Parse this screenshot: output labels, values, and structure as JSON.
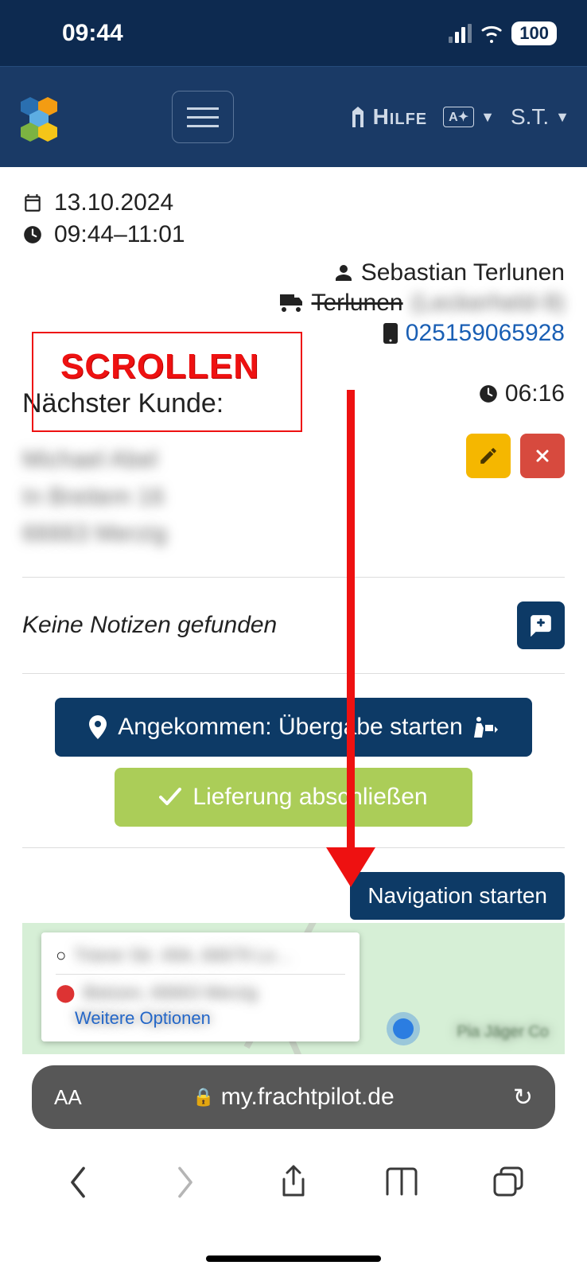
{
  "status": {
    "time": "09:44",
    "battery": "100"
  },
  "nav": {
    "help": "Hilfe",
    "lang_badge": "A✦",
    "user_short": "S.T."
  },
  "tour": {
    "date": "13.10.2024",
    "time_window": "09:44–11:01",
    "driver": "Sebastian Terlunen",
    "vehicle_name": "Terlunen",
    "vehicle_detail": "(Leckerheld-9)",
    "phone": "025159065928"
  },
  "annotation": {
    "label": "SCROLLEN"
  },
  "next": {
    "title": "Nächster Kunde:",
    "eta": "06:16",
    "customer_name": "Michael Abel",
    "street": "In Breitem 16",
    "city": "66663 Merzig"
  },
  "notes": {
    "empty_text": "Keine Notizen gefunden"
  },
  "actions": {
    "arrived": "Angekommen: Übergabe starten",
    "complete": "Lieferung abschließen",
    "start_nav": "Navigation starten"
  },
  "map": {
    "origin": "Trierer Str. 49A, 66679 Lo…",
    "dest": "Bietzen, 66663 Merzig",
    "more": "Weitere Optionen",
    "poi": "Pia Jäger Co"
  },
  "browser": {
    "url": "my.frachtpilot.de",
    "aa": "AA"
  }
}
